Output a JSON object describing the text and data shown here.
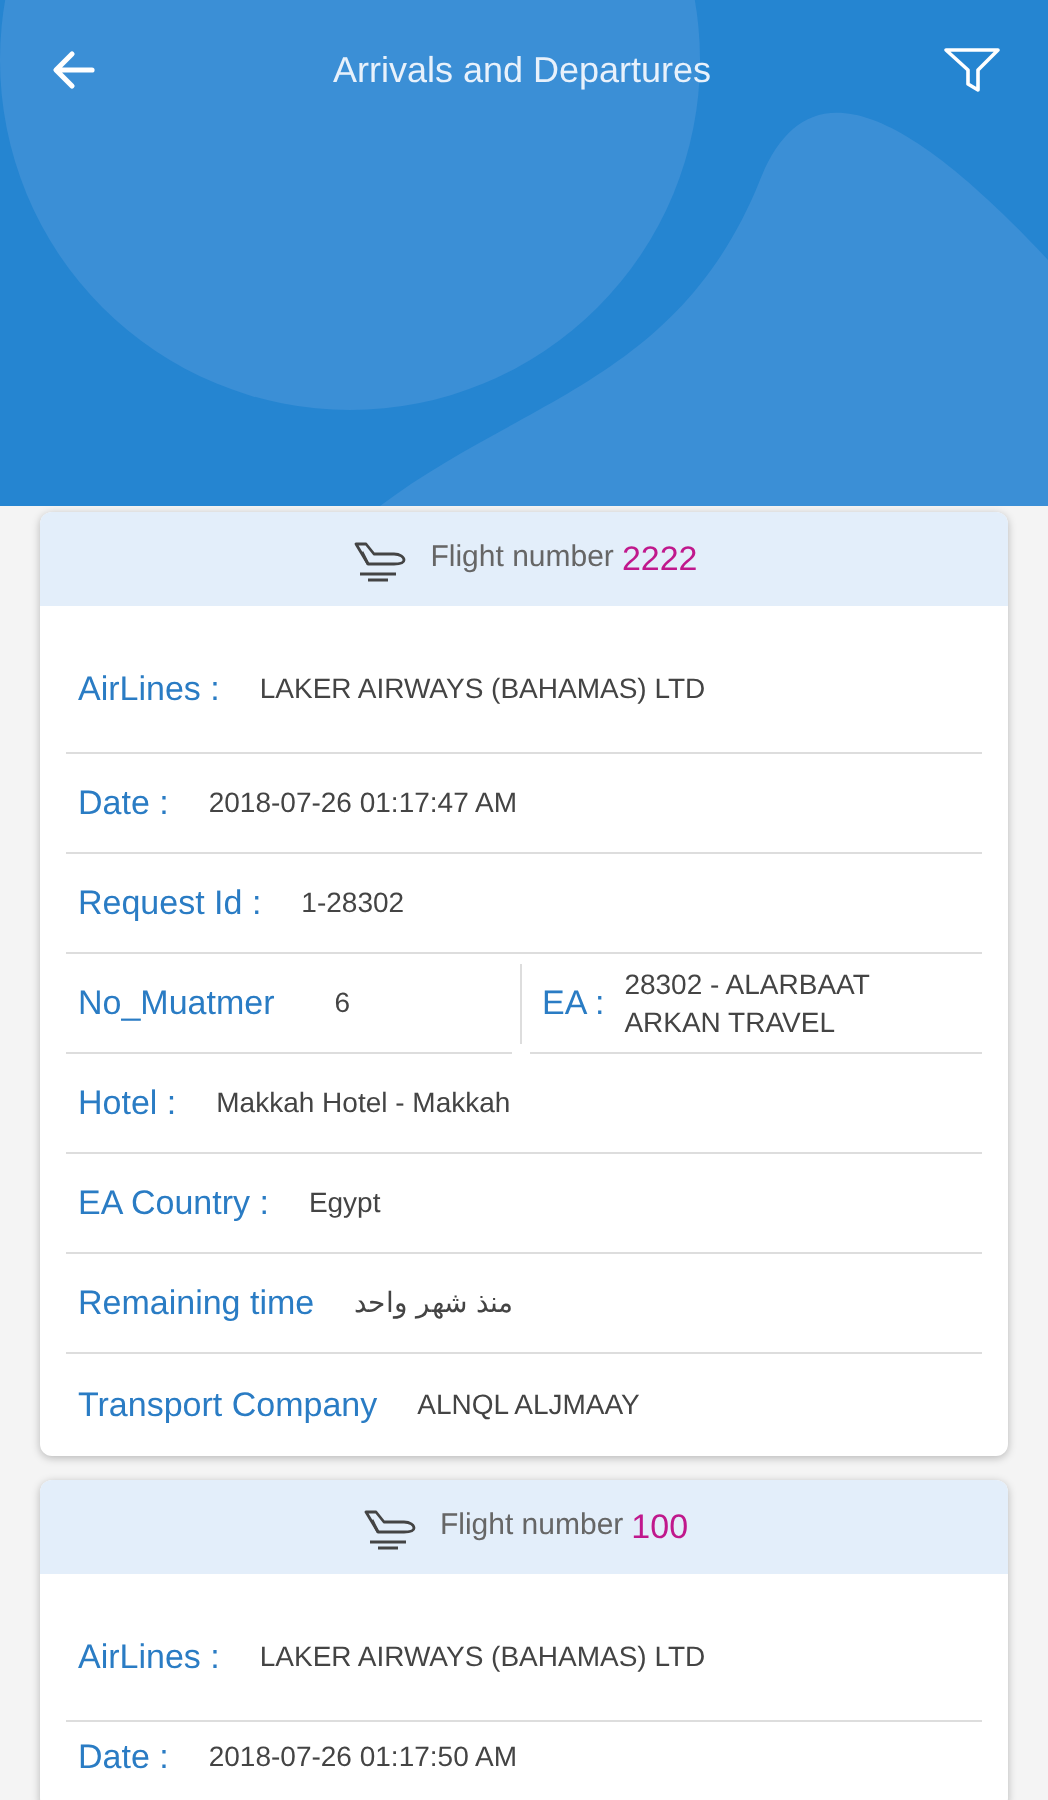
{
  "header": {
    "title": "Arrivals and Departures"
  },
  "flights": [
    {
      "flight_label": "Flight number",
      "flight_number": "2222",
      "fields": [
        {
          "kind": "row",
          "label": "AirLines :",
          "value": "LAKER AIRWAYS (BAHAMAS) LTD"
        },
        {
          "kind": "row",
          "label": "Date :",
          "value": "2018-07-26   01:17:47 AM"
        },
        {
          "kind": "row",
          "label": "Request Id :",
          "value": "1-28302"
        },
        {
          "kind": "split",
          "label": "No_Muatmer",
          "value": "6",
          "label_2": "EA :",
          "value_2": "28302 - ALARBAAT ARKAN TRAVEL"
        },
        {
          "kind": "row",
          "label": "Hotel :",
          "value": "Makkah Hotel - Makkah"
        },
        {
          "kind": "row",
          "label": "EA Country :",
          "value": "Egypt"
        },
        {
          "kind": "row",
          "label": "Remaining time",
          "value": "منذ شهر واحد"
        },
        {
          "kind": "row",
          "label": "Transport Company",
          "value": "ALNQL ALJMAAY"
        }
      ]
    },
    {
      "flight_label": "Flight number",
      "flight_number": "100",
      "fields": [
        {
          "kind": "row",
          "label": "AirLines :",
          "value": "LAKER AIRWAYS (BAHAMAS) LTD"
        },
        {
          "kind": "row",
          "label": "Date :",
          "value": "2018-07-26   01:17:50 AM"
        }
      ]
    }
  ]
}
